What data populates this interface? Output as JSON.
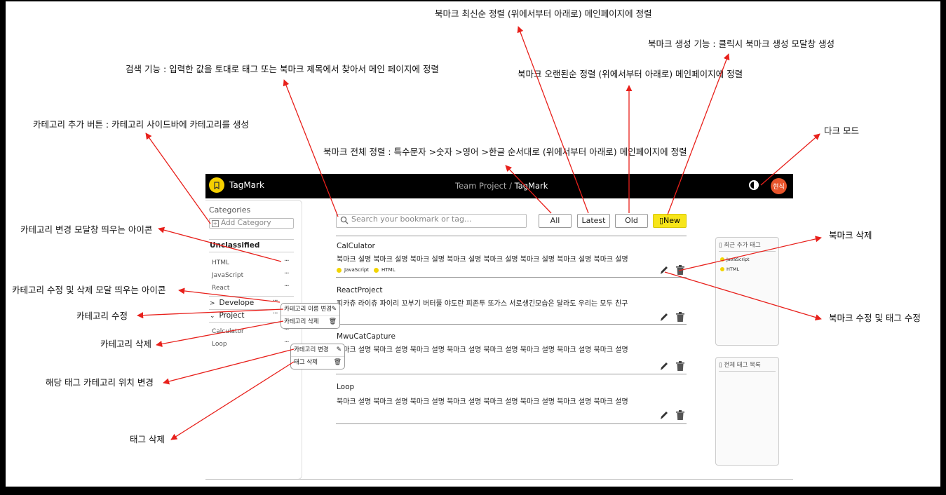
{
  "annotations": {
    "sort_latest": "북마크 최신순 정렬 (위에서부터 아래로) 메인페이지에 정렬",
    "create_bookmark": "북마크 생성 기능 : 클릭시 북마크 생성 모달창 생성",
    "search": "검색 기능 : 입력한 값을 토대로 태그 또는 북마크 제목에서 찾아서 메인 페이지에 정렬",
    "sort_old": "북마크 오랜된순 정렬 (위에서부터 아래로) 메인페이지에 정렬",
    "add_category": "카테고리 추가 버튼 : 카테고리 사이드바에 카테고리를 생성",
    "dark_mode": "다크 모드",
    "sort_all": "북마크 전체 정렬 : 특수문자 >숫자 >영어 >한글 순서대로 (위에서부터 아래로) 메인페이지에 정렬",
    "category_modal_icon": "카테고리 변경 모달창 띄우는 아이콘",
    "bookmark_delete": "북마크 삭제",
    "category_edit_delete_icon": "카테고리 수정 및 삭제 모달 띄우는 아이콘",
    "category_edit": "카테고리 수정",
    "bookmark_edit": "북마크 수정 및 태그 수정",
    "category_delete": "카테고리 삭제",
    "tag_move": "해당 태그 카테고리 위치 변경",
    "tag_delete": "태그 삭제"
  },
  "app": {
    "brand": "TagMark",
    "breadcrumb": {
      "project": "Team Project",
      "sep": "/",
      "current": "TagMark"
    },
    "avatar_text": "현식",
    "sidebar": {
      "title": "Categories",
      "add_placeholder": "Add Category",
      "group": "Unclassified",
      "items": [
        "HTML",
        "JavaScript",
        "React"
      ],
      "folders": [
        {
          "name": "Develope",
          "expanded": false
        },
        {
          "name": "Project",
          "expanded": true,
          "items": [
            "Calculator",
            "Loop"
          ]
        }
      ],
      "dots": "···"
    },
    "category_popup": {
      "rename": "카테고리 이름 변경",
      "delete": "카테고리 삭제"
    },
    "tag_popup": {
      "move": "카테고리 변경",
      "delete": "태그 삭제"
    },
    "search_placeholder": "Search your bookmark or tag...",
    "sort_buttons": {
      "all": "All",
      "latest": "Latest",
      "old": "Old",
      "new": "New"
    },
    "bookmarks": [
      {
        "title": "CalCulator",
        "desc": "북마크 설명 북마크 설명 북마크 설명 북마크 설명 북마크 설명 북마크 설명 북마크 설명 북마크 설명",
        "tags": [
          "JavaScript",
          "HTML"
        ]
      },
      {
        "title": "ReactProject",
        "desc": "피카츄 라이츄 파이리 꼬부기 버터풀 야도란 피존투 또가스 서로생긴모습은 달라도 우리는 모두 친구",
        "tags": []
      },
      {
        "title": "MwuCatCapture",
        "desc": "북마크 설명 북마크 설명 북마크 설명 북마크 설명 북마크 설명 북마크 설명 북마크 설명 북마크 설명",
        "tags": []
      },
      {
        "title": "Loop",
        "desc": "북마크 설명 북마크 설명 북마크 설명 북마크 설명 북마크 설명 북마크 설명 북마크 설명 북마크 설명",
        "tags": []
      }
    ],
    "recent_tags": {
      "title": "최근 추가 태그",
      "tags": [
        "JavaScript",
        "HTML"
      ]
    },
    "all_tags": {
      "title": "전체 태그 목록"
    }
  },
  "colors": {
    "arrow": "#e8201b",
    "topbar": "#000000",
    "new_button": "#f7e51a",
    "tag_dot": "#f2d400",
    "avatar": "#e8542b"
  }
}
